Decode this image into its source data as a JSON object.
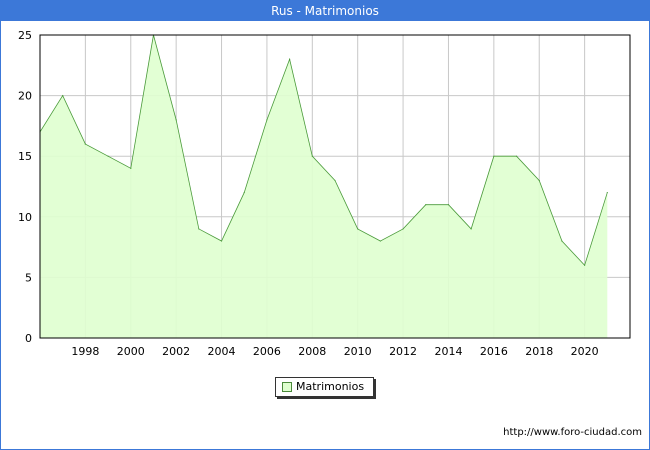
{
  "header": {
    "title": "Rus - Matrimonios"
  },
  "chart_data": {
    "type": "area",
    "title": "Rus - Matrimonios",
    "xlabel": "",
    "ylabel": "",
    "x": [
      1996,
      1997,
      1998,
      1999,
      2000,
      2001,
      2002,
      2003,
      2004,
      2005,
      2006,
      2007,
      2008,
      2009,
      2010,
      2011,
      2012,
      2013,
      2014,
      2015,
      2016,
      2017,
      2018,
      2019,
      2020,
      2021
    ],
    "series": [
      {
        "name": "Matrimonios",
        "values": [
          17,
          20,
          16,
          15,
          14,
          25,
          18,
          9,
          8,
          12,
          18,
          23,
          15,
          13,
          9,
          8,
          9,
          11,
          11,
          9,
          15,
          15,
          13,
          8,
          6,
          12
        ]
      }
    ],
    "x_ticks": [
      "1998",
      "2000",
      "2002",
      "2004",
      "2006",
      "2008",
      "2010",
      "2012",
      "2014",
      "2016",
      "2018",
      "2020"
    ],
    "y_ticks": [
      "0",
      "5",
      "10",
      "15",
      "20",
      "25"
    ],
    "ylim": [
      0,
      25
    ],
    "grid": true,
    "legend": "bottom-center",
    "colors": {
      "fill": "#dfffcf",
      "line": "#4a9a3a",
      "header": "#3c78d8",
      "grid": "#c8c8c8"
    }
  },
  "legend": {
    "label": "Matrimonios"
  },
  "footer": {
    "source_url": "http://www.foro-ciudad.com"
  }
}
